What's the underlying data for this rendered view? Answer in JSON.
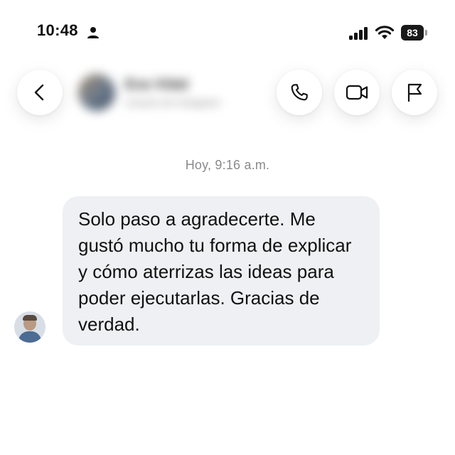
{
  "status_bar": {
    "time": "10:48",
    "battery": "83"
  },
  "header": {
    "contact_name": "Eva Vidal",
    "contact_subtitle": "Usuario de Instagram",
    "icons": {
      "back": "chevron-left-icon",
      "call": "phone-icon",
      "video": "video-camera-icon",
      "report": "flag-icon"
    }
  },
  "conversation": {
    "timestamp": "Hoy, 9:16 a.m.",
    "messages": [
      {
        "text": "Solo paso a agradecerte. Me gustó mucho tu forma de explicar y cómo aterrizas las ideas para poder ejecutarlas. Gracias de verdad."
      }
    ]
  },
  "colors": {
    "bubble_background": "#eef0f3",
    "timestamp_text": "#8a8a8e",
    "primary_text": "#111111"
  }
}
